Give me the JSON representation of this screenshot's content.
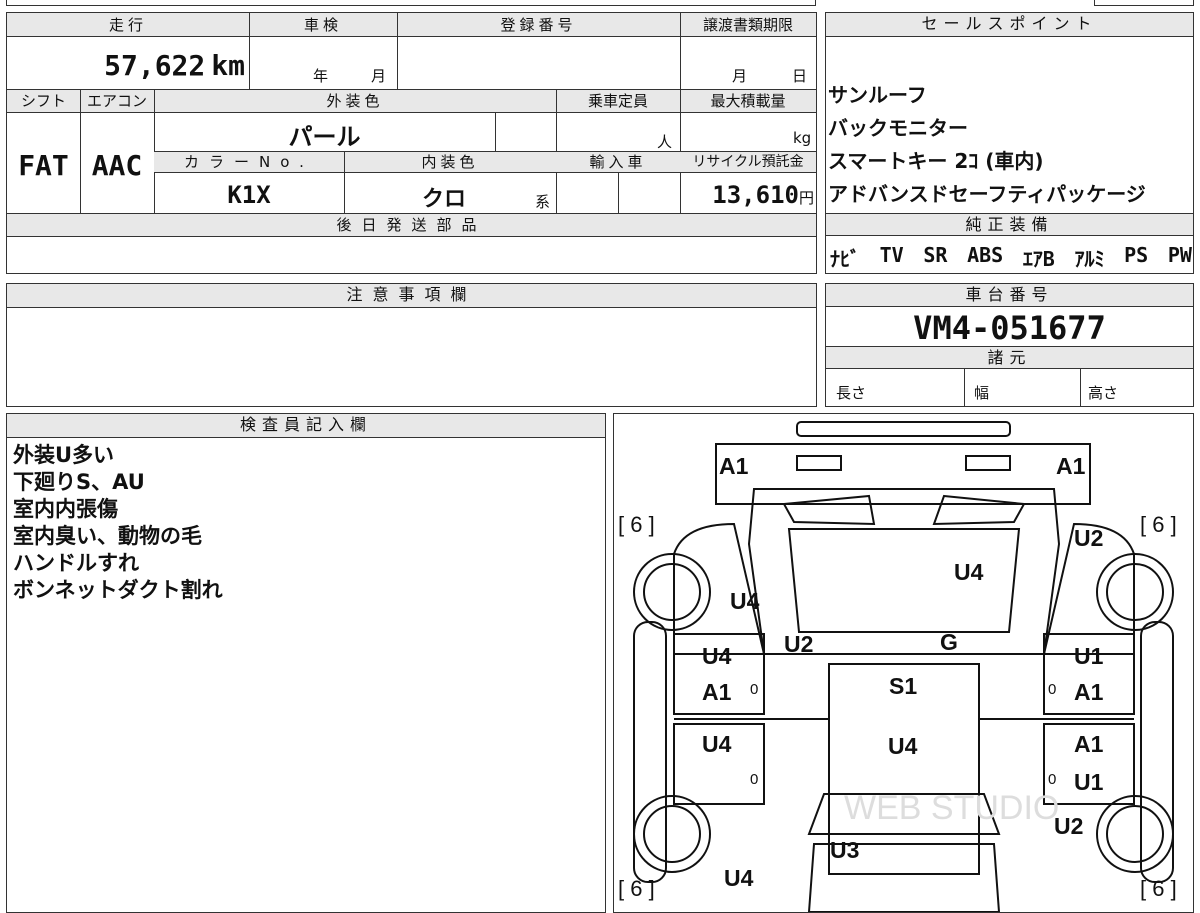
{
  "main": {
    "mileage_label": "走行",
    "mileage_value": "57,622",
    "mileage_unit": "km",
    "shaken_label": "車検",
    "shaken_year": "年",
    "shaken_month": "月",
    "reg_label": "登録番号",
    "transfer_label": "譲渡書類期限",
    "transfer_month": "月",
    "transfer_day": "日",
    "shift_label": "シフト",
    "shift_value": "FAT",
    "ac_label": "エアコン",
    "ac_value": "AAC",
    "exterior_label": "外装色",
    "exterior_value": "パール",
    "capacity_label": "乗車定員",
    "capacity_unit": "人",
    "load_label": "最大積載量",
    "load_unit": "kg",
    "color_no_label": "カラーNo.",
    "color_no_value": "K1X",
    "interior_label": "内装色",
    "interior_value": "クロ",
    "interior_suffix": "系",
    "import_label": "輸入車",
    "recycle_label": "リサイクル預託金",
    "recycle_value": "13,610",
    "recycle_unit": "円",
    "parts_label": "後日発送部品"
  },
  "sales": {
    "header": "セールスポイント",
    "items": [
      "サンルーフ",
      "バックモニター",
      "スマートキー 2ｺ (車内)",
      "アドバンスドセーフティパッケージ"
    ]
  },
  "equipment": {
    "header": "純正装備",
    "items": [
      "ﾅﾋﾞ",
      "TV",
      "SR",
      "ABS",
      "ｴｱB",
      "ｱﾙﾐ",
      "PS",
      "PW"
    ]
  },
  "notes": {
    "header": "注意事項欄"
  },
  "chassis": {
    "header": "車台番号",
    "value": "VM4-051677",
    "spec_header": "諸元",
    "length_label": "長さ",
    "width_label": "幅",
    "height_label": "高さ"
  },
  "inspector": {
    "header": "検査員記入欄",
    "lines": [
      "外装U多い",
      "下廻りS、AU",
      "室内内張傷",
      "室内臭い、動物の毛",
      "ハンドルすれ",
      "ボンネットダクト割れ"
    ]
  },
  "diagram": {
    "marks": [
      "A1",
      "A1",
      "U2",
      "U4",
      "U4",
      "U2",
      "G",
      "U4",
      "U1",
      "A1",
      "S1",
      "A1",
      "U4",
      "U4",
      "A1",
      "U1",
      "U2",
      "U3",
      "U4"
    ],
    "tread": [
      "[ 6 ]",
      "[ 6 ]",
      "[ 6 ]",
      "[ 6 ]"
    ],
    "zeros": [
      "0",
      "0",
      "0",
      "0"
    ],
    "watermark": "WEB STUDIO"
  }
}
